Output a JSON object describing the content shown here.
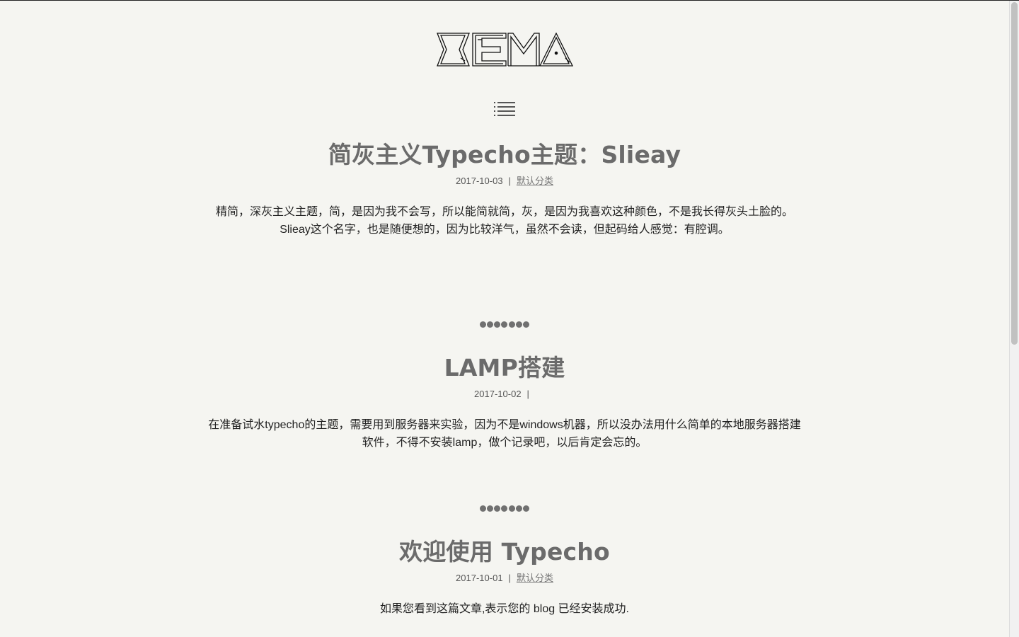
{
  "site": {
    "logo_text": "XEMA",
    "menu_icon": "menu-list-icon"
  },
  "posts": [
    {
      "title": "简灰主义Typecho主题：Slieay",
      "date": "2017-10-03",
      "separator": "|",
      "category": "默认分类",
      "excerpt_line1": "精简，深灰主义主题，简，是因为我不会写，所以能简就简，灰，是因为我喜欢这种颜色，不是我长得灰头土脸的。",
      "excerpt_line2": "Slieay这个名字，也是随便想的，因为比较洋气，虽然不会读，但起码给人感觉：有腔调。"
    },
    {
      "title": "LAMP搭建",
      "date": "2017-10-02",
      "separator": "|",
      "category": "",
      "excerpt_line1": "在准备试水typecho的主题，需要用到服务器来实验，因为不是windows机器，所以没办法用什么简单的本地服务器搭建",
      "excerpt_line2": "软件，不得不安装lamp，做个记录吧，以后肯定会忘的。"
    },
    {
      "title": "欢迎使用 Typecho",
      "date": "2017-10-01",
      "separator": "|",
      "category": "默认分类",
      "excerpt_line1": "如果您看到这篇文章,表示您的 blog 已经安装成功."
    }
  ],
  "colors": {
    "background": "#f5f5f1",
    "title": "#6b6b6b",
    "divider_dot": "#707070",
    "text": "#222222"
  }
}
